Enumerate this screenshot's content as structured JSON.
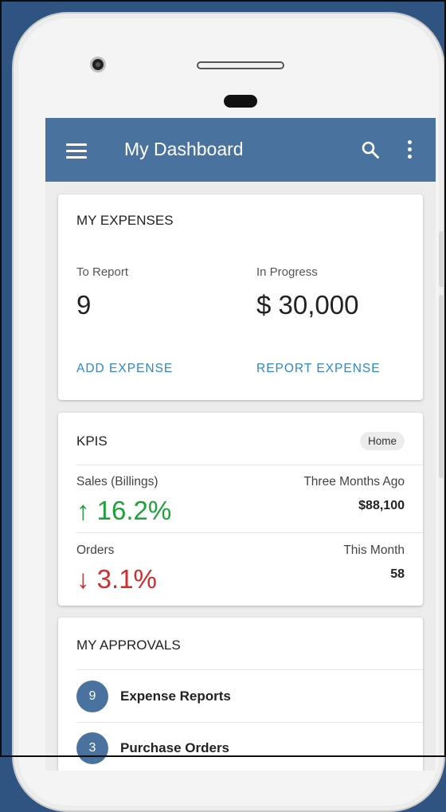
{
  "appbar": {
    "title": "My Dashboard",
    "menu_icon": "hamburger-menu-icon",
    "search_icon": "search-icon",
    "more_icon": "more-vert-icon",
    "color": "#4a729f"
  },
  "expenses": {
    "title": "MY EXPENSES",
    "to_report_label": "To Report",
    "to_report_value": "9",
    "in_progress_label": "In Progress",
    "in_progress_value": "$ 30,000",
    "add_action": "ADD EXPENSE",
    "report_action": "REPORT EXPENSE",
    "action_color": "#2d88c8"
  },
  "kpis": {
    "title": "KPIS",
    "chip": "Home",
    "rows": [
      {
        "label": "Sales (Billings)",
        "value": "↑ 16.2%",
        "right_label": "Three Months Ago",
        "right_value": "$88,100",
        "trend": "up"
      },
      {
        "label": "Orders",
        "value": "↓ 3.1%",
        "right_label": "This Month",
        "right_value": "58",
        "trend": "down"
      }
    ],
    "up_color": "#1da23a",
    "down_color": "#d42a2a"
  },
  "approvals": {
    "title": "MY APPROVALS",
    "items": [
      {
        "count": "9",
        "label": "Expense Reports"
      },
      {
        "count": "3",
        "label": "Purchase Orders"
      }
    ]
  }
}
